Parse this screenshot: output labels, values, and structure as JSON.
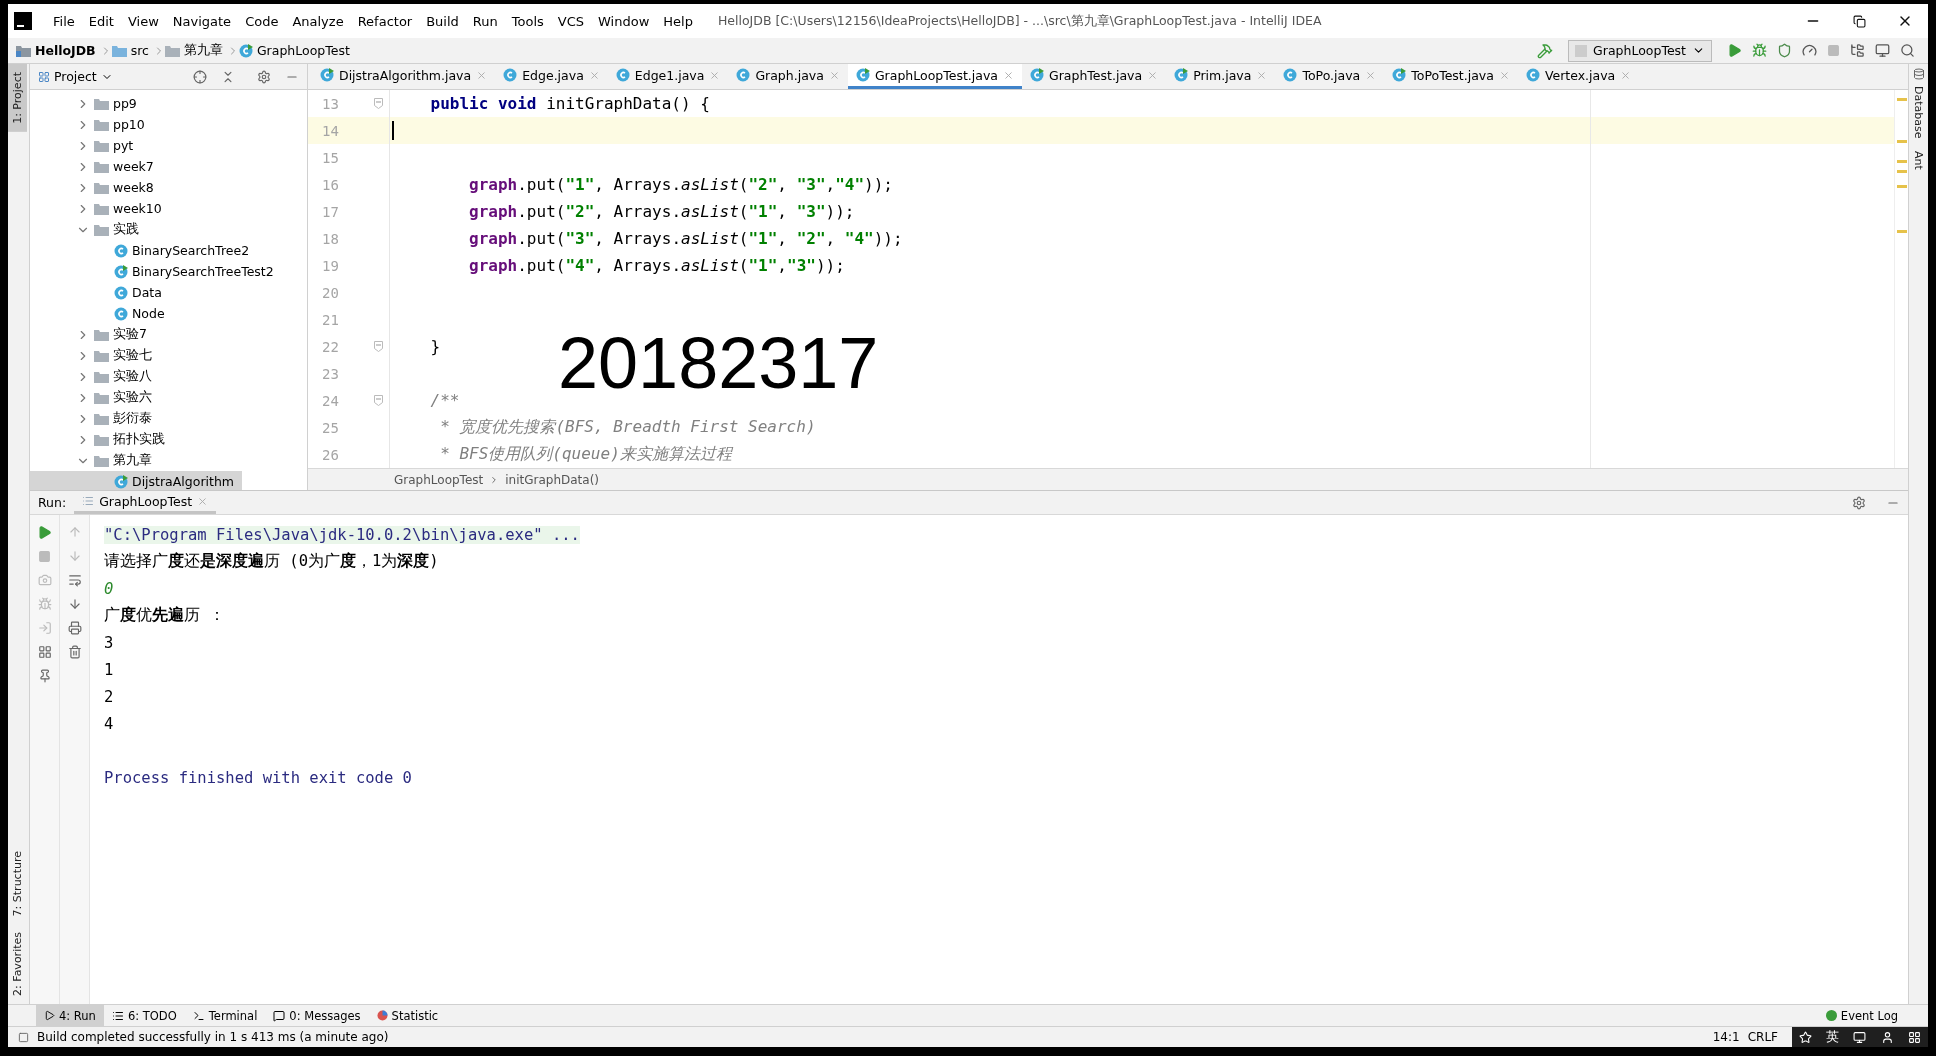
{
  "title_bar": {
    "menu": [
      "File",
      "Edit",
      "View",
      "Navigate",
      "Code",
      "Analyze",
      "Refactor",
      "Build",
      "Run",
      "Tools",
      "VCS",
      "Window",
      "Help"
    ],
    "title": "HelloJDB [C:\\Users\\12156\\IdeaProjects\\HelloJDB] - ...\\src\\第九章\\GraphLoopTest.java - IntelliJ IDEA"
  },
  "nav_bar": {
    "breadcrumb": [
      {
        "label": "HelloJDB",
        "kind": "project"
      },
      {
        "label": "src",
        "kind": "source"
      },
      {
        "label": "第九章",
        "kind": "package"
      },
      {
        "label": "GraphLoopTest",
        "kind": "runnable_class"
      }
    ],
    "run_config": "GraphLoopTest"
  },
  "left_stripe": {
    "top": [
      {
        "label": "1: Project",
        "selected": true
      }
    ],
    "bottom": [
      {
        "label": "7: Structure",
        "selected": false
      },
      {
        "label": "2: Favorites",
        "selected": false
      }
    ]
  },
  "right_stripe": [
    {
      "label": "Database",
      "selected": false
    },
    {
      "label": "Ant",
      "selected": false
    }
  ],
  "project_panel": {
    "title": "Project",
    "tree": [
      {
        "label": "pp9",
        "kind": "folder",
        "expanded": false,
        "selected": false
      },
      {
        "label": "pp10",
        "kind": "folder",
        "expanded": false,
        "selected": false
      },
      {
        "label": "pyt",
        "kind": "folder",
        "expanded": false,
        "selected": false
      },
      {
        "label": "week7",
        "kind": "folder",
        "expanded": false,
        "selected": false
      },
      {
        "label": "week8",
        "kind": "folder",
        "expanded": false,
        "selected": false
      },
      {
        "label": "week10",
        "kind": "folder",
        "expanded": false,
        "selected": false
      },
      {
        "label": "实践",
        "kind": "folder",
        "expanded": true,
        "selected": false,
        "children": [
          {
            "label": "BinarySearchTree2",
            "kind": "class",
            "selected": false
          },
          {
            "label": "BinarySearchTreeTest2",
            "kind": "runnable_class",
            "selected": false
          },
          {
            "label": "Data",
            "kind": "class",
            "selected": false
          },
          {
            "label": "Node",
            "kind": "class",
            "selected": false
          }
        ]
      },
      {
        "label": "实验7",
        "kind": "folder",
        "expanded": false,
        "selected": false
      },
      {
        "label": "实验七",
        "kind": "folder",
        "expanded": false,
        "selected": false
      },
      {
        "label": "实验八",
        "kind": "folder",
        "expanded": false,
        "selected": false
      },
      {
        "label": "实验六",
        "kind": "folder",
        "expanded": false,
        "selected": false
      },
      {
        "label": "彭衍泰",
        "kind": "folder",
        "expanded": false,
        "selected": false
      },
      {
        "label": "拓扑实践",
        "kind": "folder",
        "expanded": false,
        "selected": false
      },
      {
        "label": "第九章",
        "kind": "folder",
        "expanded": true,
        "selected": false,
        "children": [
          {
            "label": "DijstraAlgorithm",
            "kind": "runnable_class",
            "selected": true
          }
        ]
      }
    ]
  },
  "editor": {
    "tabs": [
      {
        "label": "DijstraAlgorithm.java",
        "kind": "runnable_class",
        "selected": false
      },
      {
        "label": "Edge.java",
        "kind": "class",
        "selected": false
      },
      {
        "label": "Edge1.java",
        "kind": "class",
        "selected": false
      },
      {
        "label": "Graph.java",
        "kind": "class",
        "selected": false
      },
      {
        "label": "GraphLoopTest.java",
        "kind": "runnable_class",
        "selected": true
      },
      {
        "label": "GraphTest.java",
        "kind": "runnable_class",
        "selected": false
      },
      {
        "label": "Prim.java",
        "kind": "runnable_class",
        "selected": false
      },
      {
        "label": "ToPo.java",
        "kind": "class",
        "selected": false
      },
      {
        "label": "ToPoTest.java",
        "kind": "runnable_class",
        "selected": false
      },
      {
        "label": "Vertex.java",
        "kind": "class",
        "selected": false
      }
    ],
    "lines": [
      {
        "number": "13",
        "fold": true,
        "current": false,
        "segments": [
          {
            "text": "    public",
            "kind": "keyword"
          },
          {
            "text": " void",
            "kind": "keyword"
          },
          {
            "text": " initGraphData() {",
            "kind": "plain"
          }
        ]
      },
      {
        "number": "14",
        "fold": false,
        "current": true
      },
      {
        "number": "15",
        "fold": false,
        "current": false
      },
      {
        "number": "16",
        "fold": false,
        "current": false,
        "segments": [
          {
            "text": "        graph",
            "kind": "field"
          },
          {
            "text": ".put(",
            "kind": "plain"
          },
          {
            "text": "\"1\"",
            "kind": "string"
          },
          {
            "text": ", Arrays.",
            "kind": "plain"
          },
          {
            "text": "asList",
            "kind": "method"
          },
          {
            "text": "(",
            "kind": "plain"
          },
          {
            "text": "\"2\"",
            "kind": "string"
          },
          {
            "text": ", ",
            "kind": "plain"
          },
          {
            "text": "\"3\"",
            "kind": "string"
          },
          {
            "text": ",",
            "kind": "plain"
          },
          {
            "text": "\"4\"",
            "kind": "string"
          },
          {
            "text": "));",
            "kind": "plain"
          }
        ]
      },
      {
        "number": "17",
        "fold": false,
        "current": false,
        "segments": [
          {
            "text": "        graph",
            "kind": "field"
          },
          {
            "text": ".put(",
            "kind": "plain"
          },
          {
            "text": "\"2\"",
            "kind": "string"
          },
          {
            "text": ", Arrays.",
            "kind": "plain"
          },
          {
            "text": "asList",
            "kind": "method"
          },
          {
            "text": "(",
            "kind": "plain"
          },
          {
            "text": "\"1\"",
            "kind": "string"
          },
          {
            "text": ", ",
            "kind": "plain"
          },
          {
            "text": "\"3\"",
            "kind": "string"
          },
          {
            "text": "));",
            "kind": "plain"
          }
        ]
      },
      {
        "number": "18",
        "fold": false,
        "current": false,
        "segments": [
          {
            "text": "        graph",
            "kind": "field"
          },
          {
            "text": ".put(",
            "kind": "plain"
          },
          {
            "text": "\"3\"",
            "kind": "string"
          },
          {
            "text": ", Arrays.",
            "kind": "plain"
          },
          {
            "text": "asList",
            "kind": "method"
          },
          {
            "text": "(",
            "kind": "plain"
          },
          {
            "text": "\"1\"",
            "kind": "string"
          },
          {
            "text": ", ",
            "kind": "plain"
          },
          {
            "text": "\"2\"",
            "kind": "string"
          },
          {
            "text": ", ",
            "kind": "plain"
          },
          {
            "text": "\"4\"",
            "kind": "string"
          },
          {
            "text": "));",
            "kind": "plain"
          }
        ]
      },
      {
        "number": "19",
        "fold": false,
        "current": false,
        "segments": [
          {
            "text": "        graph",
            "kind": "field"
          },
          {
            "text": ".put(",
            "kind": "plain"
          },
          {
            "text": "\"4\"",
            "kind": "string"
          },
          {
            "text": ", Arrays.",
            "kind": "plain"
          },
          {
            "text": "asList",
            "kind": "method"
          },
          {
            "text": "(",
            "kind": "plain"
          },
          {
            "text": "\"1\"",
            "kind": "string"
          },
          {
            "text": ",",
            "kind": "plain"
          },
          {
            "text": "\"3\"",
            "kind": "string"
          },
          {
            "text": "));",
            "kind": "plain"
          }
        ]
      },
      {
        "number": "20",
        "fold": false,
        "current": false
      },
      {
        "number": "21",
        "fold": false,
        "current": false
      },
      {
        "number": "22",
        "fold": true,
        "current": false,
        "segments": [
          {
            "text": "    }",
            "kind": "plain"
          }
        ]
      },
      {
        "number": "23",
        "fold": false,
        "current": false
      },
      {
        "number": "24",
        "fold": true,
        "current": false,
        "segments": [
          {
            "text": "    /**",
            "kind": "comment"
          }
        ]
      },
      {
        "number": "25",
        "fold": false,
        "current": false,
        "segments": [
          {
            "text": "     * 宽度优先搜索(BFS, Breadth First Search)",
            "kind": "comment"
          }
        ]
      },
      {
        "number": "26",
        "fold": false,
        "current": false,
        "segments": [
          {
            "text": "     * BFS使用队列(queue)来实施算法过程",
            "kind": "comment"
          }
        ]
      }
    ],
    "overlay_text": "20182317",
    "breadcrumb": [
      "GraphLoopTest",
      "initGraphData()"
    ]
  },
  "run_panel": {
    "label": "Run:",
    "tab": "GraphLoopTest",
    "console": [
      {
        "text": "\"C:\\Program Files\\Java\\jdk-10.0.2\\bin\\java.exe\" ...",
        "kind": "command"
      },
      {
        "text": "请选择广**度**还**是深度遍**历 (0为广**度**，1为**深度**)",
        "kind": "output"
      },
      {
        "text": "0",
        "kind": "input"
      },
      {
        "text": "广**度**优**先遍**历 ：",
        "kind": "output"
      },
      {
        "text": "3",
        "kind": "output"
      },
      {
        "text": "1",
        "kind": "output"
      },
      {
        "text": "2",
        "kind": "output"
      },
      {
        "text": "4",
        "kind": "output"
      },
      {
        "text": "Process finished with exit code 0",
        "kind": "exit"
      }
    ]
  },
  "bottom_tabs": [
    {
      "label": "4: Run",
      "kind": "run",
      "selected": true
    },
    {
      "label": "6: TODO",
      "kind": "todo",
      "selected": false
    },
    {
      "label": "Terminal",
      "kind": "terminal",
      "selected": false
    },
    {
      "label": "0: Messages",
      "kind": "messages",
      "selected": false
    },
    {
      "label": "Statistic",
      "kind": "statistic",
      "selected": false
    }
  ],
  "event_log": "Event Log",
  "status_bar": {
    "message": "Build completed successfully in 1 s 413 ms (a minute ago)",
    "position": "14:1",
    "line_separator": "CRLF"
  },
  "ime_tray": {
    "mode": "英"
  }
}
